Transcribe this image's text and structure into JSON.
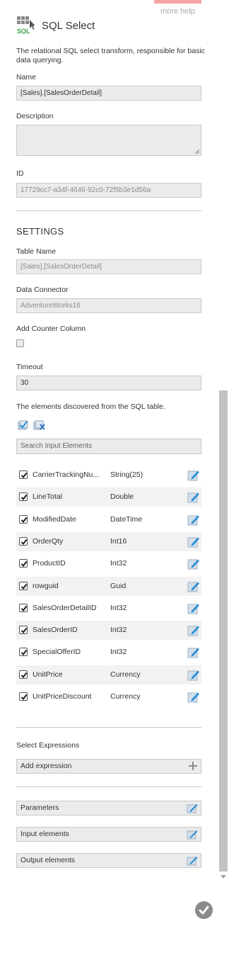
{
  "help": {
    "more_help": "more help"
  },
  "header": {
    "title": "SQL Select",
    "icon": "sql-icon"
  },
  "description": "The relational SQL select transform, responsible for basic data querying.",
  "fields": {
    "name_label": "Name",
    "name_value": "[Sales].[SalesOrderDetail]",
    "description_label": "Description",
    "description_value": "",
    "id_label": "ID",
    "id_value": "17729cc7-a34f-4646-92c0-72f5b3e1d56a"
  },
  "settings": {
    "title": "SETTINGS",
    "table_name_label": "Table Name",
    "table_name_value": "[Sales].[SalesOrderDetail]",
    "data_connector_label": "Data Connector",
    "data_connector_value": "AdventureWorks16",
    "add_counter_label": "Add Counter Column",
    "add_counter_checked": false,
    "timeout_label": "Timeout",
    "timeout_value": "30",
    "discovered_text": "The elements discovered from the SQL table.",
    "search_placeholder": "Search Input Elements"
  },
  "elements": [
    {
      "name": "CarrierTrackingNu...",
      "type": "String(25)",
      "checked": true
    },
    {
      "name": "LineTotal",
      "type": "Double",
      "checked": true
    },
    {
      "name": "ModifiedDate",
      "type": "DateTime",
      "checked": true
    },
    {
      "name": "OrderQty",
      "type": "Int16",
      "checked": true
    },
    {
      "name": "ProductID",
      "type": "Int32",
      "checked": true
    },
    {
      "name": "rowguid",
      "type": "Guid",
      "checked": true
    },
    {
      "name": "SalesOrderDetailID",
      "type": "Int32",
      "checked": true
    },
    {
      "name": "SalesOrderID",
      "type": "Int32",
      "checked": true
    },
    {
      "name": "SpecialOfferID",
      "type": "Int32",
      "checked": true
    },
    {
      "name": "UnitPrice",
      "type": "Currency",
      "checked": true
    },
    {
      "name": "UnitPriceDiscount",
      "type": "Currency",
      "checked": true
    }
  ],
  "expressions": {
    "label": "Select Expressions",
    "add_label": "Add expression"
  },
  "bottom_bars": {
    "parameters": "Parameters",
    "input_elements": "Input elements",
    "output_elements": "Output elements"
  },
  "colors": {
    "accent_blue": "#2a8fd8",
    "icon_green": "#3a9b4a",
    "ok_gray": "#8a8a8a"
  }
}
